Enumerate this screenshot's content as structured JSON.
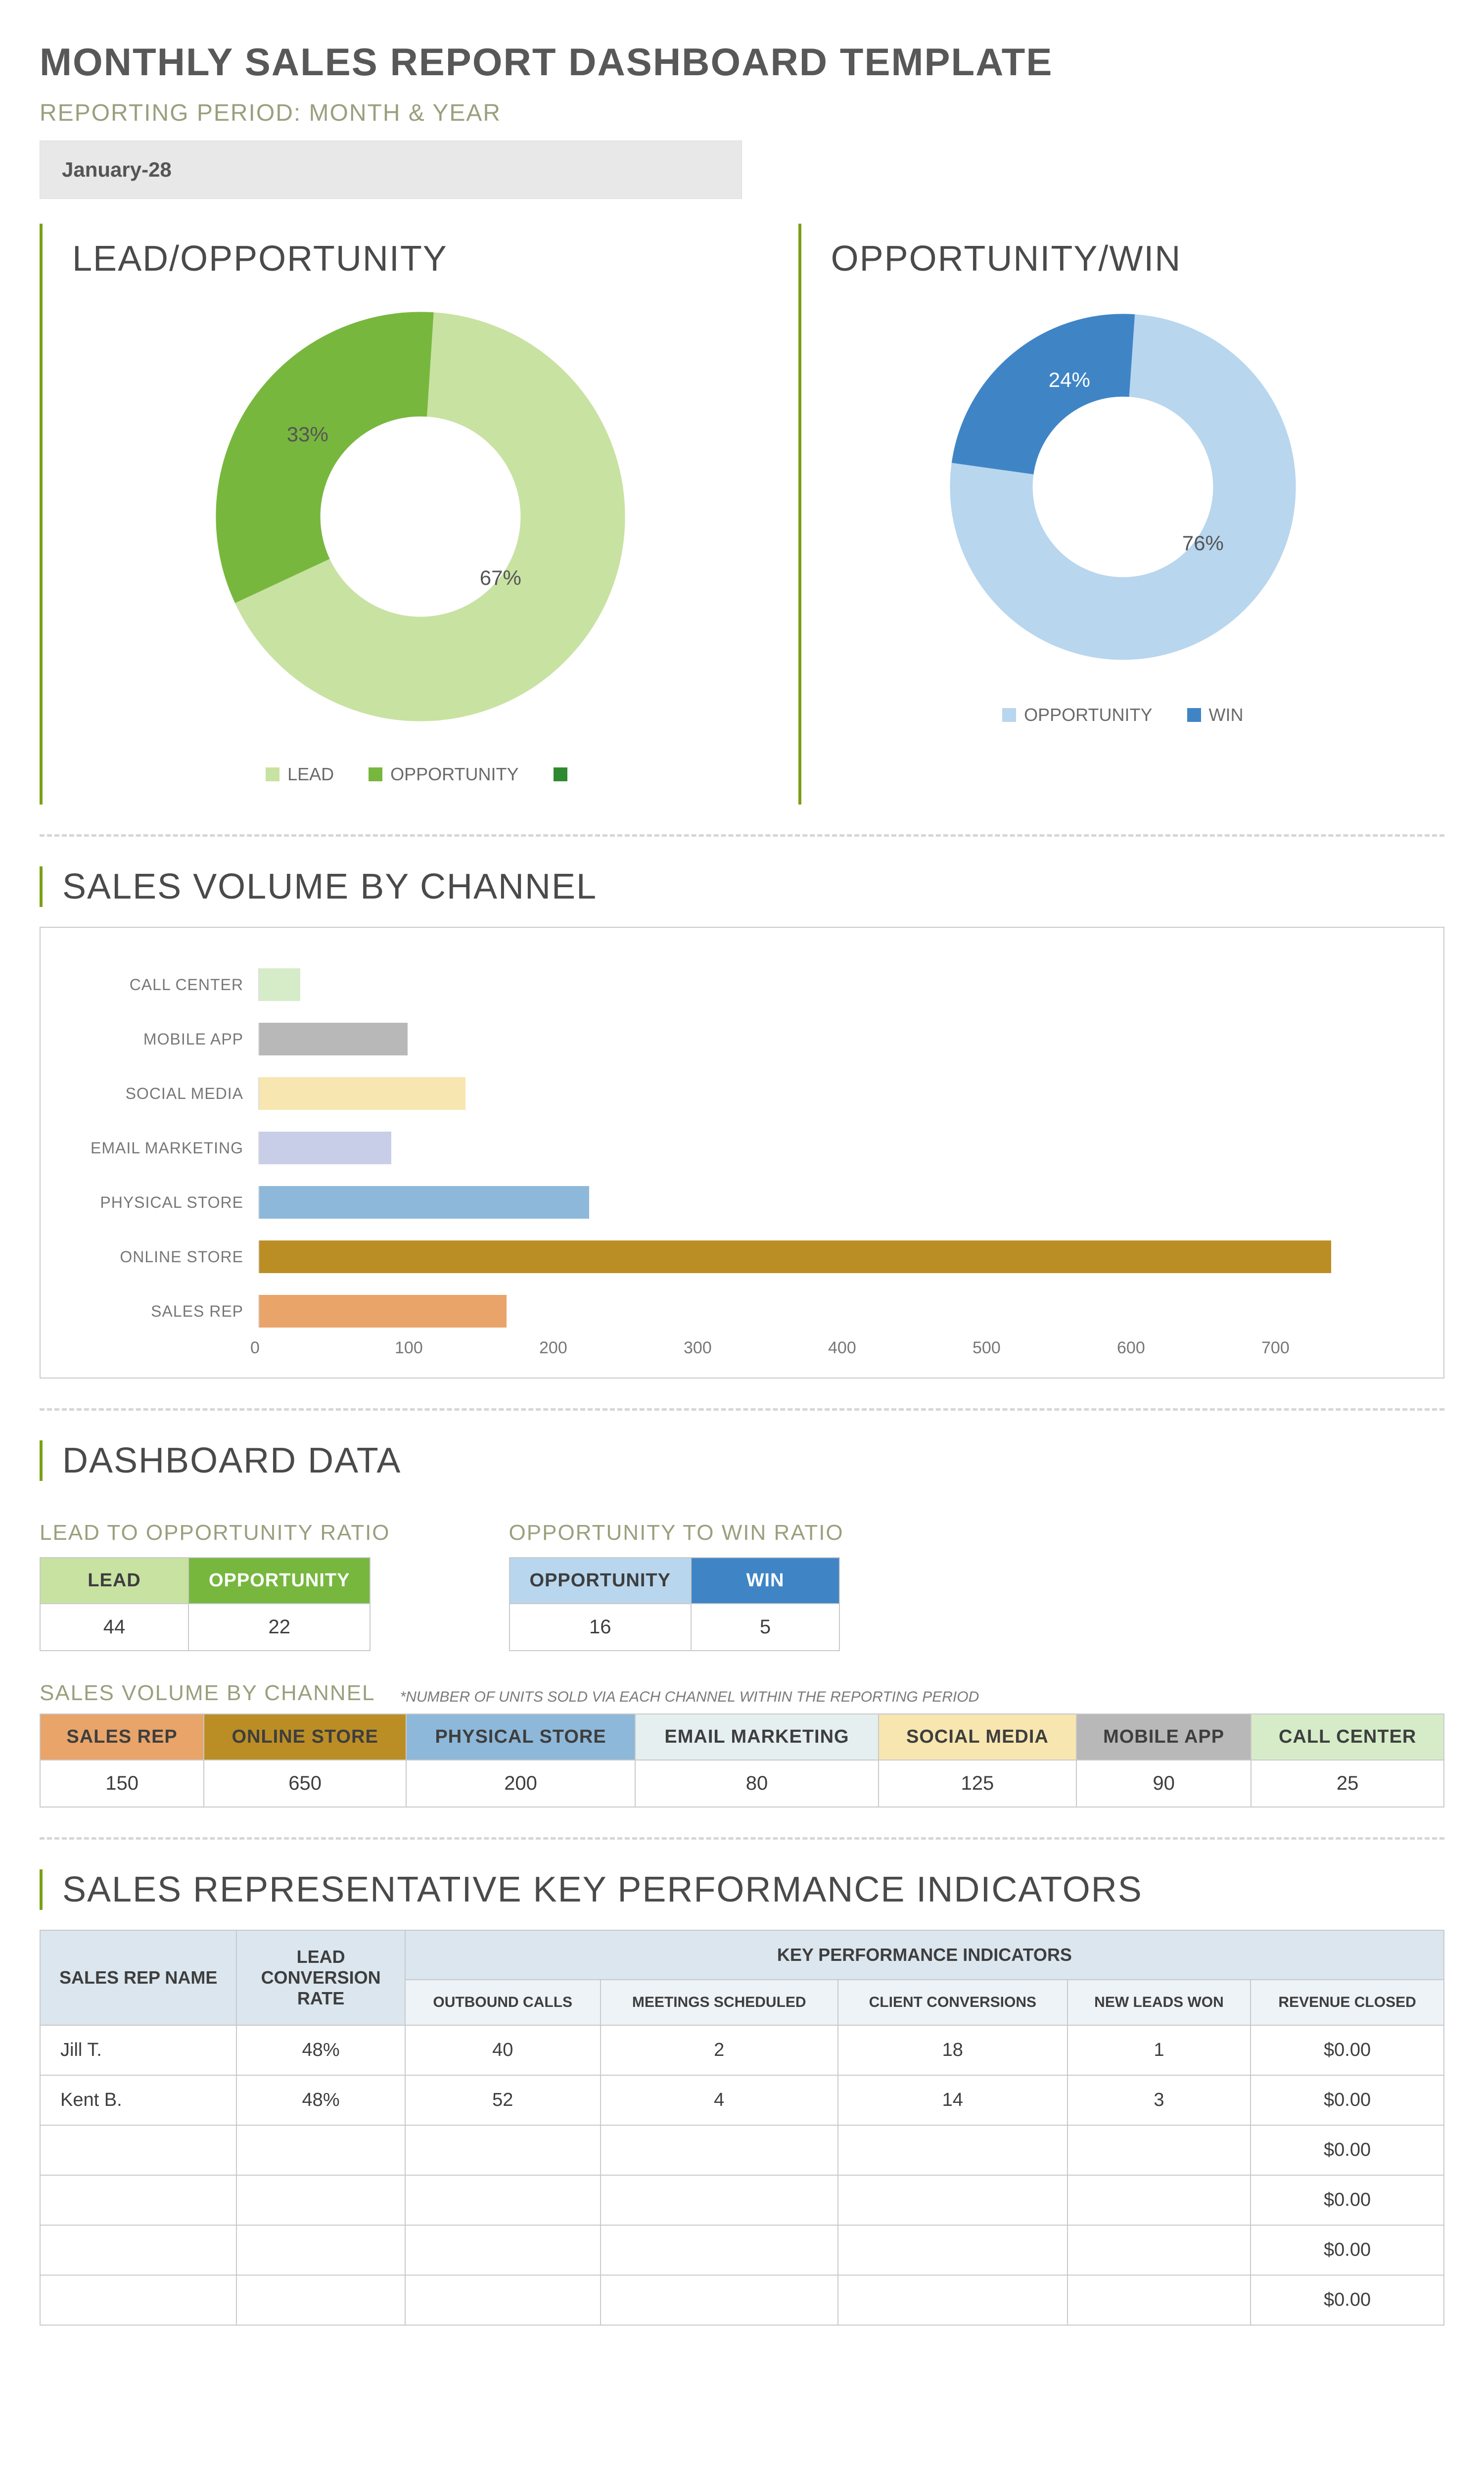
{
  "title": "MONTHLY SALES REPORT DASHBOARD TEMPLATE",
  "subtitle": "REPORTING PERIOD: MONTH & YEAR",
  "period": "January-28",
  "sections": {
    "lead_opp": {
      "title": "LEAD/OPPORTUNITY",
      "legend": [
        "LEAD",
        "OPPORTUNITY"
      ],
      "ghost": " "
    },
    "opp_win": {
      "title": "OPPORTUNITY/WIN",
      "legend": [
        "OPPORTUNITY",
        "WIN"
      ]
    },
    "volume": {
      "title": "SALES VOLUME BY CHANNEL"
    },
    "data": {
      "title": "DASHBOARD DATA"
    },
    "ratio1": {
      "title": "LEAD TO OPPORTUNITY RATIO",
      "cols": [
        "LEAD",
        "OPPORTUNITY"
      ],
      "vals": [
        "44",
        "22"
      ]
    },
    "ratio2": {
      "title": "OPPORTUNITY TO WIN RATIO",
      "cols": [
        "OPPORTUNITY",
        "WIN"
      ],
      "vals": [
        "16",
        "5"
      ]
    },
    "vol_tbl": {
      "title": "SALES VOLUME BY CHANNEL",
      "note": "*NUMBER OF UNITS SOLD VIA EACH CHANNEL WITHIN THE REPORTING PERIOD",
      "cols": [
        "SALES REP",
        "ONLINE STORE",
        "PHYSICAL STORE",
        "EMAIL MARKETING",
        "SOCIAL MEDIA",
        "MOBILE APP",
        "CALL CENTER"
      ],
      "vals": [
        "150",
        "650",
        "200",
        "80",
        "125",
        "90",
        "25"
      ]
    },
    "kpi": {
      "title": "SALES REPRESENTATIVE KEY PERFORMANCE INDICATORS",
      "main_cols": [
        "SALES REP NAME",
        "LEAD CONVERSION RATE",
        "KEY PERFORMANCE INDICATORS"
      ],
      "sub_cols": [
        "OUTBOUND CALLS",
        "MEETINGS SCHEDULED",
        "CLIENT CONVERSIONS",
        "NEW LEADS WON",
        "REVENUE CLOSED"
      ],
      "rows": [
        {
          "name": "Jill T.",
          "rate": "48%",
          "v": [
            "40",
            "2",
            "18",
            "1",
            "$0.00"
          ]
        },
        {
          "name": "Kent B.",
          "rate": "48%",
          "v": [
            "52",
            "4",
            "14",
            "3",
            "$0.00"
          ]
        },
        {
          "name": "",
          "rate": "",
          "v": [
            "",
            "",
            "",
            "",
            "$0.00"
          ]
        },
        {
          "name": "",
          "rate": "",
          "v": [
            "",
            "",
            "",
            "",
            "$0.00"
          ]
        },
        {
          "name": "",
          "rate": "",
          "v": [
            "",
            "",
            "",
            "",
            "$0.00"
          ]
        },
        {
          "name": "",
          "rate": "",
          "v": [
            "",
            "",
            "",
            "",
            "$0.00"
          ]
        }
      ]
    }
  },
  "chart_data": [
    {
      "type": "pie",
      "title": "LEAD/OPPORTUNITY",
      "series": [
        {
          "name": "LEAD",
          "value": 67,
          "color": "#c8e2a2"
        },
        {
          "name": "OPPORTUNITY",
          "value": 33,
          "color": "#77b73e"
        }
      ],
      "labels": [
        "67%",
        "33%"
      ]
    },
    {
      "type": "pie",
      "title": "OPPORTUNITY/WIN",
      "series": [
        {
          "name": "OPPORTUNITY",
          "value": 76,
          "color": "#b8d6ee"
        },
        {
          "name": "WIN",
          "value": 24,
          "color": "#3f85c6"
        }
      ],
      "labels": [
        "76%",
        "24%"
      ]
    },
    {
      "type": "bar",
      "title": "SALES VOLUME BY CHANNEL",
      "orientation": "horizontal",
      "xlim": [
        0,
        700
      ],
      "xticks": [
        0,
        100,
        200,
        300,
        400,
        500,
        600,
        700
      ],
      "categories": [
        "CALL CENTER",
        "MOBILE APP",
        "SOCIAL MEDIA",
        "EMAIL MARKETING",
        "PHYSICAL STORE",
        "ONLINE STORE",
        "SALES REP"
      ],
      "values": [
        25,
        90,
        125,
        80,
        200,
        650,
        150
      ],
      "colors": [
        "#d6ecc9",
        "#b8b8b8",
        "#f7e6b0",
        "#c9cee8",
        "#8db8da",
        "#bb8e25",
        "#e9a46a"
      ]
    }
  ]
}
